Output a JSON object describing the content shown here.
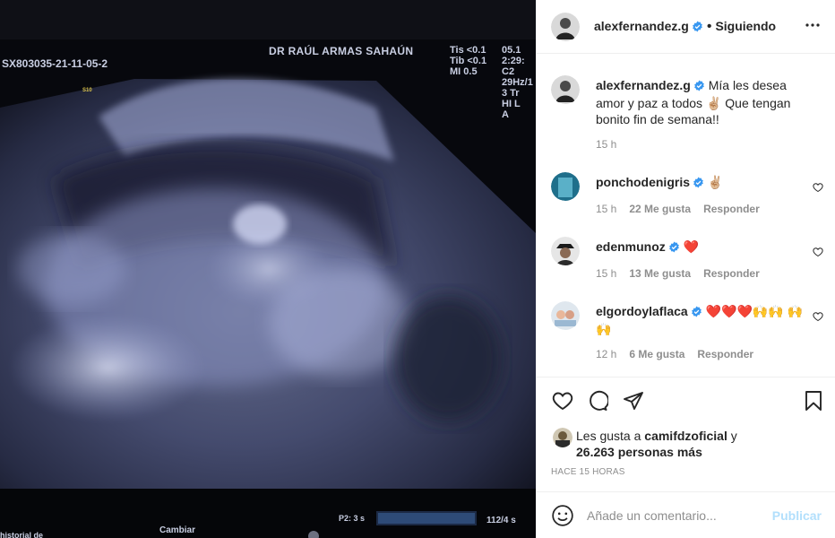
{
  "ultrasound": {
    "doctor": "DR RAÚL ARMAS SAHAÚN",
    "study_id": "SX803035-21-11-05-2",
    "tis": "Tis <0.1",
    "tib": "Tib <0.1",
    "mi": "MI  0.5",
    "right_1": "05.1",
    "right_2": "2:29:",
    "right_3": "C2",
    "right_4": "29Hz/1",
    "right_5": "3 Tr",
    "right_6": "HI L",
    "right_7": "A",
    "small_label": "S10",
    "p2": "P2:",
    "p2_val": "3 s",
    "fps": "112/4 s",
    "cambiar": "Cambiar",
    "historial": "historial de"
  },
  "header": {
    "username": "alexfernandez.g",
    "separator": "•",
    "follow_label": "Siguiendo"
  },
  "caption": {
    "username": "alexfernandez.g",
    "text": "Mía les desea amor y paz a todos ✌🏼 Que tengan bonito fin de semana!!",
    "time": "15 h"
  },
  "comments": [
    {
      "username": "ponchodenigris",
      "text": "✌🏼",
      "time": "15 h",
      "likes": "22 Me gusta",
      "reply": "Responder"
    },
    {
      "username": "edenmunoz",
      "text": "❤️",
      "time": "15 h",
      "likes": "13 Me gusta",
      "reply": "Responder"
    },
    {
      "username": "elgordoylaflaca",
      "text": "❤️❤️❤️🙌🙌 🙌🙌",
      "time": "12 h",
      "likes": "6 Me gusta",
      "reply": "Responder"
    }
  ],
  "likes": {
    "prefix": "Les gusta a",
    "user": "camifdzoficial",
    "conj": "y",
    "others": "26.263 personas más"
  },
  "time_ago": "HACE 15 HORAS",
  "add_comment": {
    "placeholder": "Añade un comentario...",
    "publish": "Publicar"
  },
  "colors": {
    "verified": "#3897f0",
    "heart_red": "#ed4956",
    "publish_disabled": "#b2dffc"
  }
}
